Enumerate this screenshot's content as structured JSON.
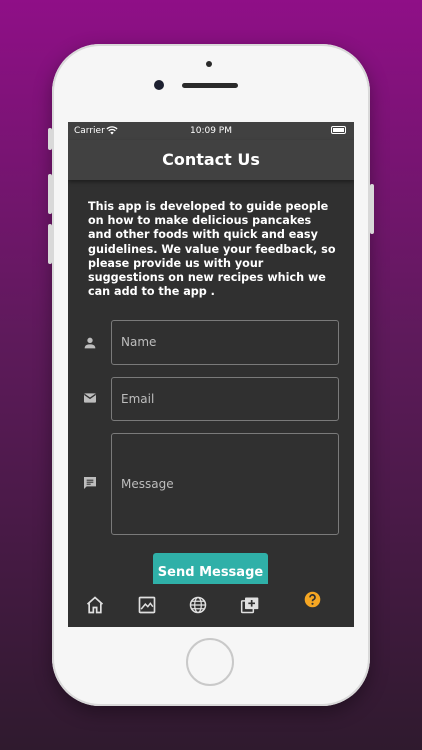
{
  "status_bar": {
    "carrier": "Carrier",
    "time": "10:09 PM"
  },
  "app_bar": {
    "title": "Contact Us"
  },
  "intro_text": "This app is developed to guide people on how to make delicious pancakes and other foods with quick and easy guidelines. We value your feedback, so please provide us with your suggestions on new recipes which we can add to the app .",
  "form": {
    "name_placeholder": "Name",
    "email_placeholder": "Email",
    "message_placeholder": "Message",
    "send_label": "Send Message"
  },
  "bottom_nav": {
    "items": [
      {
        "icon": "home-icon"
      },
      {
        "icon": "gallery-icon"
      },
      {
        "icon": "globe-icon"
      },
      {
        "icon": "add-to-collection-icon"
      },
      {
        "icon": "help-icon",
        "active": true
      }
    ]
  },
  "colors": {
    "background_gradient_top": "#8f0f87",
    "background_gradient_bottom": "#2f1a2e",
    "screen_bg": "#303030",
    "app_bar_bg": "#414141",
    "accent_button": "#2fb0a8",
    "help_icon": "#f5a623"
  }
}
